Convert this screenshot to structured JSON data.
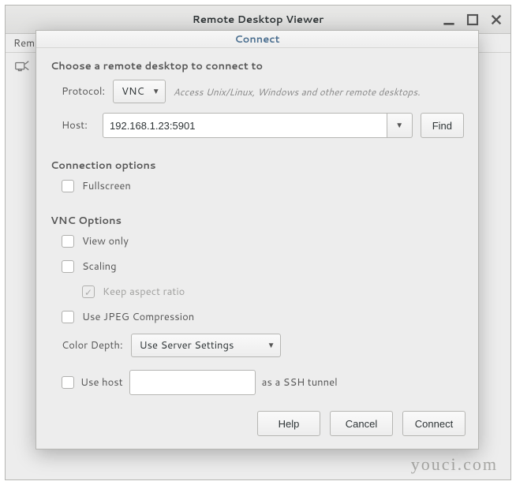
{
  "window": {
    "title": "Remote Desktop Viewer",
    "menubar_partial": "Remo"
  },
  "dialog": {
    "title": "Connect",
    "heading_choose": "Choose a remote desktop to connect to",
    "protocol_label": "Protocol:",
    "protocol_value": "VNC",
    "protocol_hint": "Access Unix/Linux, Windows and other remote desktops.",
    "host_label": "Host:",
    "host_value": "192.168.1.23:5901",
    "find_label": "Find",
    "heading_conn_options": "Connection options",
    "fullscreen_label": "Fullscreen",
    "heading_vnc_options": "VNC Options",
    "view_only_label": "View only",
    "scaling_label": "Scaling",
    "keep_aspect_label": "Keep aspect ratio",
    "jpeg_label": "Use JPEG Compression",
    "color_depth_label": "Color Depth:",
    "color_depth_value": "Use Server Settings",
    "ssh_use_host_label": "Use host",
    "ssh_suffix": "as a SSH tunnel",
    "help_label": "Help",
    "cancel_label": "Cancel",
    "connect_label": "Connect"
  },
  "watermark": "youci.com"
}
